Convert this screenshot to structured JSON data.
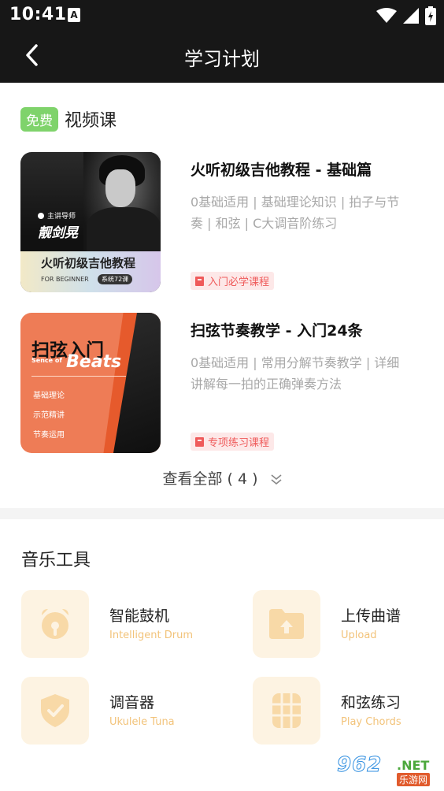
{
  "status_bar": {
    "time": "10:41",
    "notification_letter": "A"
  },
  "header": {
    "title": "学习计划"
  },
  "video_section": {
    "badge": "免费",
    "title": "视频课",
    "courses": [
      {
        "title": "火听初级吉他教程 - 基础篇",
        "description": "0基础适用 | 基础理论知识 | 拍子与节奏 | 和弦 | C大调音阶练习",
        "tag": "入门必学课程",
        "thumb": {
          "teacher_label": "主讲导师",
          "teacher_name": "靓剑晃",
          "title": "火听初级吉他教程",
          "subtitle": "FOR BEGINNER",
          "pill": "系统72课"
        }
      },
      {
        "title": "扫弦节奏教学 - 入门24条",
        "description": "0基础适用 | 常用分解节奏教学 | 详细讲解每一拍的正确弹奏方法",
        "tag": "专项练习课程",
        "thumb": {
          "title": "扫弦入门",
          "subtitle": "Sence of",
          "beats": "Beats",
          "items": [
            "基础理论",
            "示范精讲",
            "节奏运用"
          ]
        }
      }
    ],
    "view_all": "查看全部 ( 4 )"
  },
  "tools_section": {
    "title": "音乐工具",
    "tools": [
      {
        "name": "智能鼓机",
        "en": "Intelligent Drum",
        "icon": "drum-machine-icon"
      },
      {
        "name": "上传曲谱",
        "en": "Upload",
        "icon": "upload-folder-icon"
      },
      {
        "name": "调音器",
        "en": "Ukulele Tuna",
        "icon": "tuner-icon"
      },
      {
        "name": "和弦练习",
        "en": "Play Chords",
        "icon": "chord-grid-icon"
      }
    ]
  },
  "watermark": {
    "number": "962",
    "net": ".NET",
    "cn": "乐游网"
  },
  "colors": {
    "header_bg": "#171717",
    "free_badge": "#7fd36b",
    "tag_red": "#ef5a5a",
    "tool_accent": "#f2c37a",
    "tool_bg": "#fdf3e2"
  }
}
